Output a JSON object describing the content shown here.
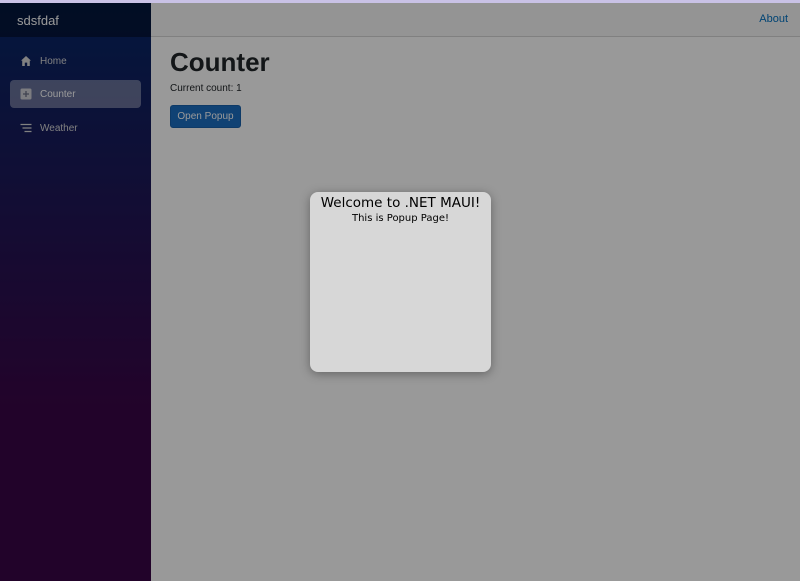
{
  "sidebar": {
    "brand": "sdsfdaf",
    "items": [
      {
        "label": "Home",
        "icon": "home-icon",
        "active": false
      },
      {
        "label": "Counter",
        "icon": "plus-icon",
        "active": true
      },
      {
        "label": "Weather",
        "icon": "list-icon",
        "active": false
      }
    ]
  },
  "header": {
    "about_label": "About"
  },
  "main": {
    "title": "Counter",
    "count_text": "Current count: 1",
    "open_popup_label": "Open Popup"
  },
  "popup": {
    "title": "Welcome to .NET MAUI!",
    "subtitle": "This is Popup Page!"
  },
  "colors": {
    "accent": "#1b6ec2",
    "link": "#0071c1",
    "sidebar_top": "#052767",
    "sidebar_bottom": "#3a0647",
    "popup_bg": "#d7d7d7"
  }
}
